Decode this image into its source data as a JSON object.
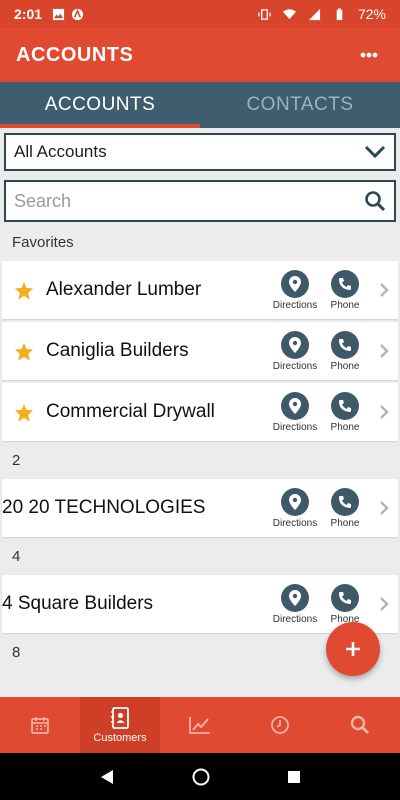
{
  "status_bar": {
    "time": "2:01",
    "battery": "72%"
  },
  "app_bar": {
    "title": "ACCOUNTS"
  },
  "tabs": [
    {
      "label": "ACCOUNTS"
    },
    {
      "label": "CONTACTS"
    }
  ],
  "filter": {
    "selected": "All Accounts"
  },
  "search": {
    "placeholder": "Search"
  },
  "sections": {
    "favorites": "Favorites",
    "s2": "2",
    "s4": "4",
    "s8": "8"
  },
  "accounts": [
    {
      "name": "Alexander Lumber",
      "favorite": true
    },
    {
      "name": "Caniglia Builders",
      "favorite": true
    },
    {
      "name": "Commercial Drywall",
      "favorite": true
    },
    {
      "name": "20 20 TECHNOLOGIES",
      "favorite": false
    },
    {
      "name": "4 Square Builders",
      "favorite": false
    }
  ],
  "actions": {
    "directions": "Directions",
    "phone": "Phone"
  },
  "bottom_nav": {
    "customers": "Customers"
  },
  "colors": {
    "brand": "#e04a30",
    "tab_bg": "#3f5d6e",
    "star": "#f2b01e"
  }
}
